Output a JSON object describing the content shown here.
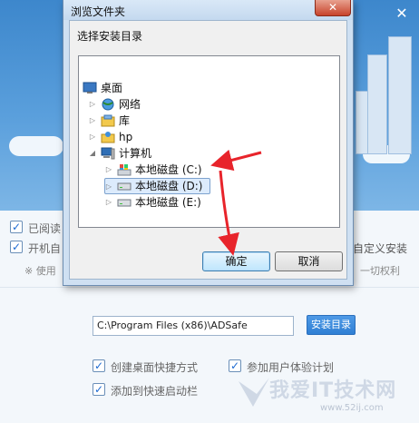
{
  "installer": {
    "close_glyph": "✕",
    "checkbox_labels": [
      "已阅读",
      "开机自"
    ],
    "note_prefix": "※ 使用",
    "right_fragments": [
      "自定义安装",
      "一切权利"
    ],
    "install_path": "C:\\Program Files (x86)\\ADSafe",
    "install_dir_button": "安装目录",
    "options": [
      {
        "label": "创建桌面快捷方式",
        "checked": true
      },
      {
        "label": "参加用户体验计划",
        "checked": true
      },
      {
        "label": "添加到快速启动栏",
        "checked": true
      }
    ]
  },
  "dialog": {
    "title": "浏览文件夹",
    "close_glyph": "✕",
    "instruction": "选择安装目录",
    "tree": [
      {
        "label": "桌面",
        "icon": "desktop-icon"
      },
      {
        "label": "网络",
        "icon": "network-icon"
      },
      {
        "label": "库",
        "icon": "library-icon"
      },
      {
        "label": "hp",
        "icon": "user-folder-icon"
      },
      {
        "label": "计算机",
        "icon": "computer-icon"
      },
      {
        "label": "本地磁盘 (C:)",
        "icon": "system-drive-icon"
      },
      {
        "label": "本地磁盘 (D:)",
        "icon": "drive-icon",
        "selected": true
      },
      {
        "label": "本地磁盘 (E:)",
        "icon": "drive-icon"
      }
    ],
    "ok_label": "确定",
    "cancel_label": "取消"
  },
  "watermark": {
    "text": "我爱IT技术网",
    "url": "www.52ij.com"
  },
  "colors": {
    "banner_blue": "#3d87cc",
    "annotation_red": "#e8242b",
    "selection": "#dcebfc",
    "accent_button": "#2f7fd4"
  }
}
